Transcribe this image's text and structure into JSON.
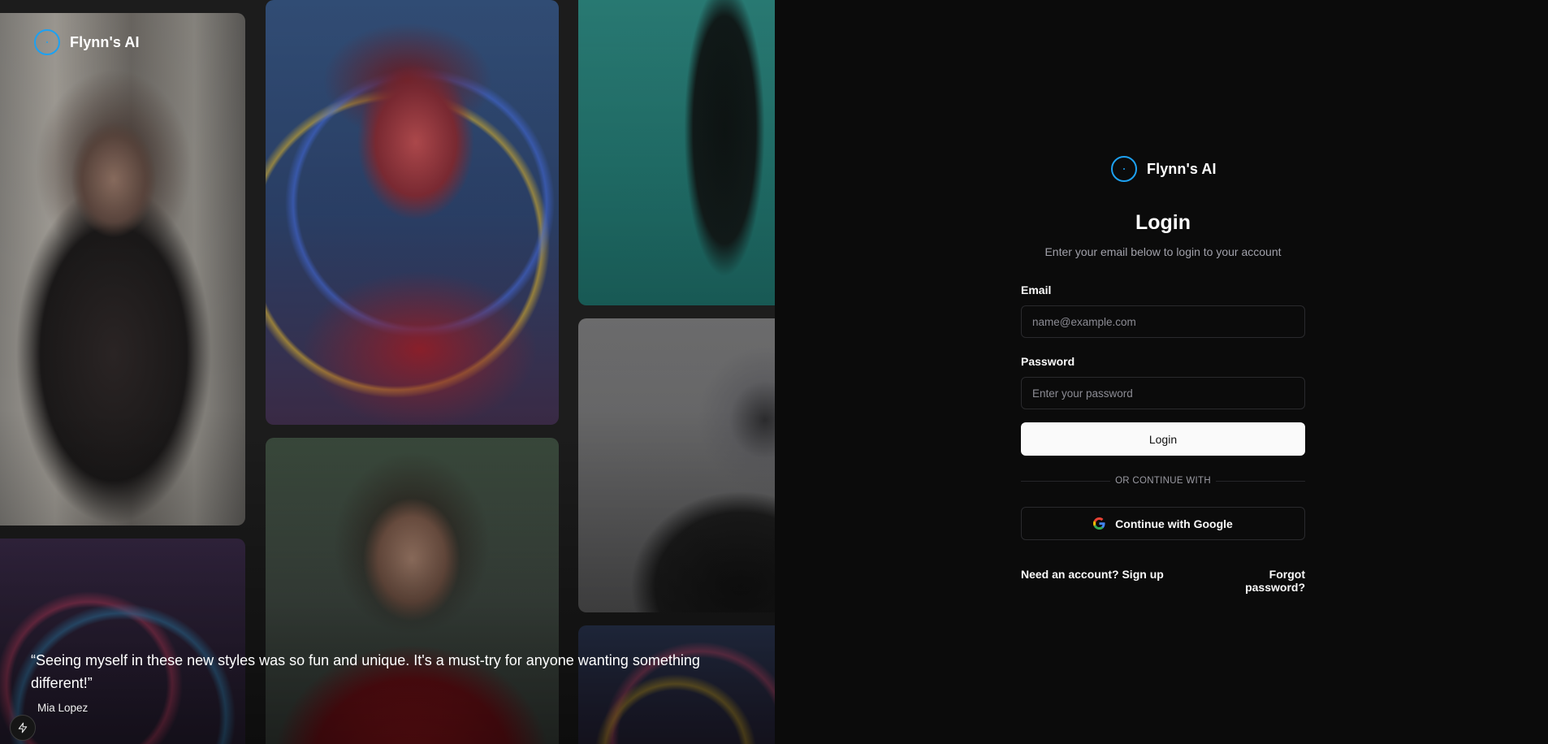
{
  "brand": {
    "name": "Flynn's AI",
    "accent": "#1da1f2"
  },
  "testimonial": {
    "quote": "“Seeing myself in these new styles was so fun and unique. It's a must-try for anyone wanting something different!”",
    "author": "Mia Lopez"
  },
  "gallery": {
    "tiles": [
      {
        "subject": "woman-black-dress"
      },
      {
        "subject": "woman-neon-rings"
      },
      {
        "subject": "person-suit-teal"
      },
      {
        "subject": "helmet-portrait"
      },
      {
        "subject": "woman-red-blazer"
      },
      {
        "subject": "neon-rings"
      },
      {
        "subject": "neon-rings"
      }
    ]
  },
  "login": {
    "title": "Login",
    "subtitle": "Enter your email below to login to your account",
    "email_label": "Email",
    "email_placeholder": "name@example.com",
    "email_value": "",
    "password_label": "Password",
    "password_placeholder": "Enter your password",
    "password_value": "",
    "submit_label": "Login",
    "divider_text": "OR CONTINUE WITH",
    "google_label": "Continue with Google",
    "signup_link": "Need an account? Sign up",
    "forgot_link": "Forgot password?"
  },
  "icons": {
    "logo": "circle-logo-icon",
    "google": "google-icon",
    "bolt": "bolt-icon"
  },
  "colors": {
    "background": "#0b0b0b",
    "primary_button": "#fafafa",
    "muted_text": "#a1a1aa",
    "border": "#2a2a2d"
  }
}
